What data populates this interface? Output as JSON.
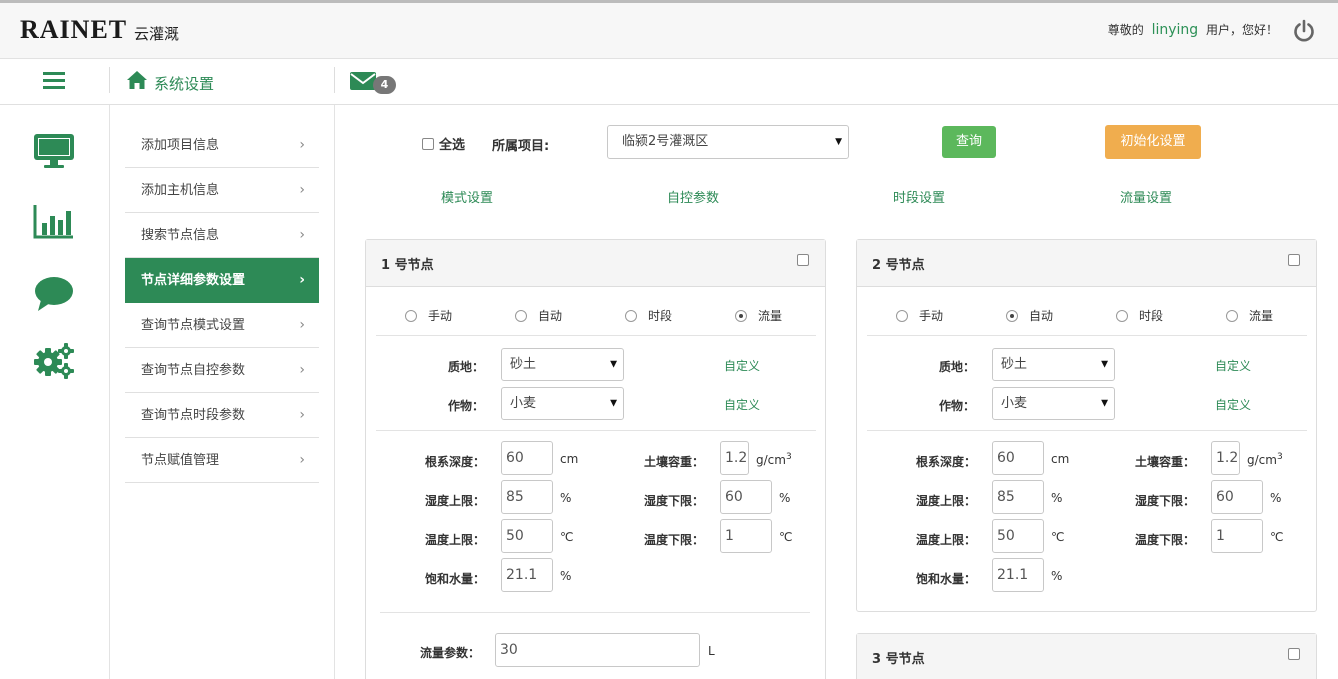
{
  "header": {
    "logo": "RAINET",
    "logo_sub": "云灌溉",
    "greet_prefix": "尊敬的",
    "username": "linying",
    "greet_suffix": "用户，您好！"
  },
  "nav": {
    "title": "系统设置",
    "mail_count": "4"
  },
  "rail_icons": [
    "monitor-icon",
    "bar-chart-icon",
    "chat-bubble-icon",
    "gears-icon"
  ],
  "menu": {
    "items": [
      {
        "label": "添加项目信息"
      },
      {
        "label": "添加主机信息"
      },
      {
        "label": "搜索节点信息"
      },
      {
        "label": "节点详细参数设置"
      },
      {
        "label": "查询节点模式设置"
      },
      {
        "label": "查询节点自控参数"
      },
      {
        "label": "查询节点时段参数"
      },
      {
        "label": "节点赋值管理"
      }
    ],
    "active_index": 3,
    "chevron": "›"
  },
  "toolbar": {
    "select_all": "全选",
    "project_label": "所属项目:",
    "project_value": "临颍2号灌溉区",
    "query_button": "查询",
    "init_button": "初始化设置"
  },
  "tabs": [
    "模式设置",
    "自控参数",
    "时段设置",
    "流量设置"
  ],
  "modes": [
    "手动",
    "自动",
    "时段",
    "流量"
  ],
  "labels": {
    "soil": "质地：",
    "crop": "作物：",
    "custom": "自定义",
    "root_depth": "根系深度：",
    "bulk_density": "土壤容重：",
    "humidity_upper": "湿度上限：",
    "humidity_lower": "湿度下限：",
    "temp_upper": "温度上限：",
    "temp_lower": "温度下限：",
    "saturation": "饱和水量：",
    "flow_param": "流量参数："
  },
  "units": {
    "cm": "cm",
    "density": "g/cm",
    "density_exp": "3",
    "percent": "%",
    "celsius": "℃",
    "liter": "L"
  },
  "nodes": [
    {
      "title": "1 号节点",
      "selected_mode": "流量",
      "soil": "砂土",
      "crop": "小麦",
      "root_depth": "60",
      "bulk_density": "1.2",
      "humidity_upper": "85",
      "humidity_lower": "60",
      "temp_upper": "50",
      "temp_lower": "1",
      "saturation": "21.1",
      "flow_param": "30"
    },
    {
      "title": "2 号节点",
      "selected_mode": "自动",
      "soil": "砂土",
      "crop": "小麦",
      "root_depth": "60",
      "bulk_density": "1.2",
      "humidity_upper": "85",
      "humidity_lower": "60",
      "temp_upper": "50",
      "temp_lower": "1",
      "saturation": "21.1"
    },
    {
      "title": "3 号节点"
    }
  ],
  "colors": {
    "brand_green": "#2d8a56",
    "query_green": "#5cb85c",
    "init_orange": "#f0ad4e",
    "badge_gray": "#777777"
  }
}
